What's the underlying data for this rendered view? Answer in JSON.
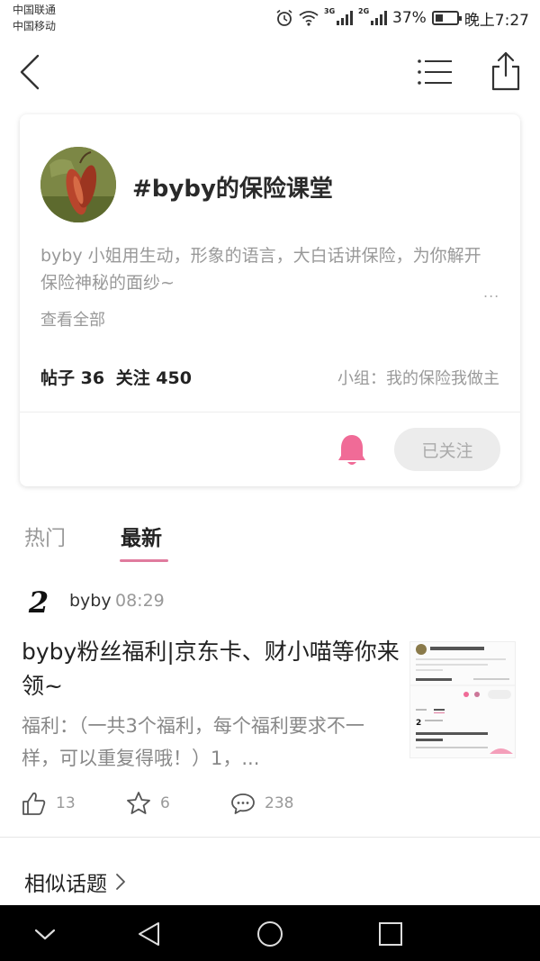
{
  "status_bar": {
    "carrier_1": "中国联通",
    "carrier_2": "中国移动",
    "network_1": "3G",
    "network_2": "2G",
    "battery": "37%",
    "battery_level": 0.37,
    "time": "晚上7:27"
  },
  "topic": {
    "title": "#byby的保险课堂",
    "description": "byby 小姐用生动，形象的语言，大白话讲保险，为你解开保险神秘的面纱~",
    "more": "...",
    "view_all": "查看全部",
    "posts_label": "帖子 36",
    "follows_label": "关注 450",
    "group": "小组：我的保险我做主",
    "follow_button": "已关注"
  },
  "tabs": {
    "hot": "热门",
    "latest": "最新",
    "active": "latest"
  },
  "post": {
    "author_icon_text": "2",
    "author": "byby",
    "time": "08:29",
    "title": "byby粉丝福利|京东卡、财小喵等你来领~",
    "excerpt": "福利：（一共3个福利，每个福利要求不一样，可以重复得哦！）1，...",
    "likes": "13",
    "favorites": "6",
    "comments": "238"
  },
  "similar_topics": "相似话题",
  "colors": {
    "accent_pink": "#e07b9e",
    "bell_pink": "#f06b97"
  }
}
